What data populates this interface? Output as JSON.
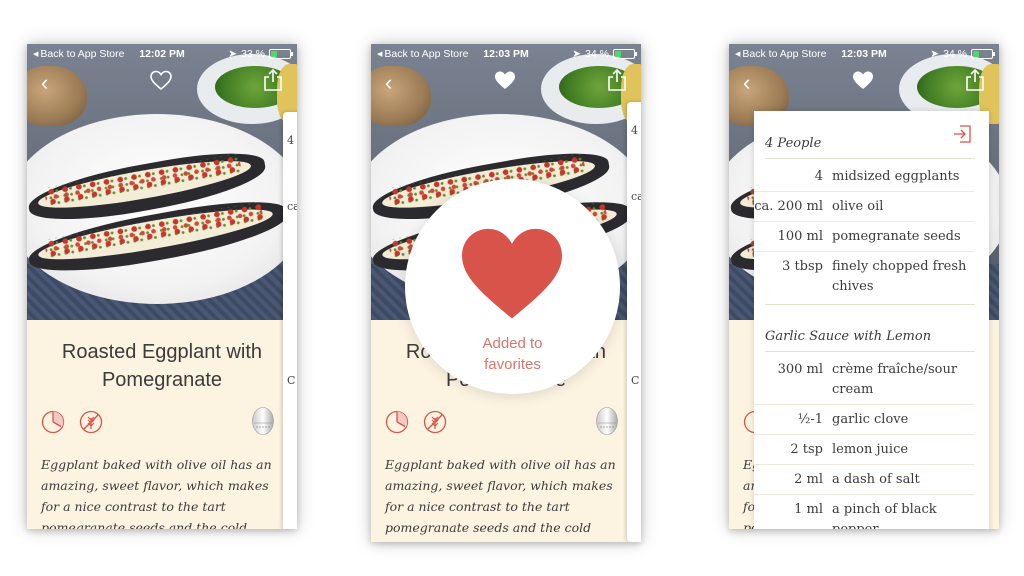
{
  "status_bar": {
    "back_label": "Back to App Store",
    "screens": [
      {
        "time": "12:02 PM",
        "battery": "33 %",
        "battery_level": 0.33
      },
      {
        "time": "12:03 PM",
        "battery": "34 %",
        "battery_level": 0.34
      },
      {
        "time": "12:03 PM",
        "battery": "34 %",
        "battery_level": 0.34
      }
    ]
  },
  "recipe": {
    "title_line1": "Roasted Eggplant with",
    "title_line2": "Pomegranate",
    "description_lines": [
      "Eggplant baked with olive oil has an",
      "amazing, sweet flavor, which makes",
      "for a nice contrast to the tart",
      "pomegranate seeds and the cold"
    ]
  },
  "favorite_toast": {
    "line1": "Added to",
    "line2": "favorites"
  },
  "peek_labels": [
    "4",
    "ca",
    "C"
  ],
  "ingredients": {
    "serving_label": "4 People",
    "main": [
      {
        "qty": "4",
        "name": "midsized eggplants"
      },
      {
        "qty": "ca. 200 ml",
        "name": "olive oil"
      },
      {
        "qty": "100 ml",
        "name": "pomegranate seeds"
      },
      {
        "qty": "3 tbsp",
        "name": "finely chopped fresh",
        "name2": "chives"
      }
    ],
    "sauce_title": "Garlic Sauce with Lemon",
    "sauce": [
      {
        "qty": "300 ml",
        "name": "crème fraîche/sour",
        "name2": "cream"
      },
      {
        "qty": "½-1",
        "name": "garlic clove"
      },
      {
        "qty": "2 tsp",
        "name": "lemon juice"
      },
      {
        "qty": "2 ml",
        "name": "a dash of salt"
      },
      {
        "qty": "1 ml",
        "name": "a pinch of black",
        "name2": "pepper"
      }
    ]
  },
  "colors": {
    "accent": "#d8534a",
    "cream": "#fcf3e1",
    "toast_text": "#d8756a"
  }
}
